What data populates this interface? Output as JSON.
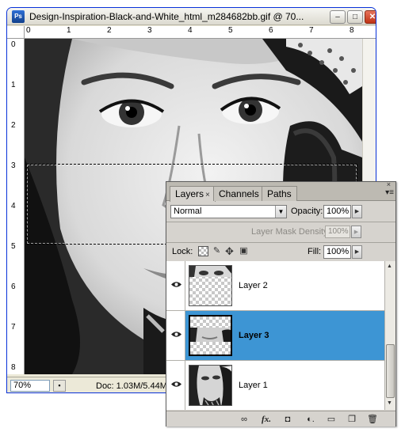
{
  "document_window": {
    "title": "Design-Inspiration-Black-and-White_html_m284682bb.gif @ 70...",
    "app_icon_text": "Ps",
    "minimize": "–",
    "maximize": "□",
    "close": "✕",
    "ruler_top_labels": [
      "0",
      "1",
      "2",
      "3",
      "4",
      "5",
      "6",
      "7",
      "8"
    ],
    "ruler_left_labels": [
      "0",
      "1",
      "2",
      "3",
      "4",
      "5",
      "6",
      "7",
      "8"
    ],
    "status": {
      "zoom": "70%",
      "doc_size": "Doc: 1.03M/5.44M"
    }
  },
  "layers_panel": {
    "tabs": [
      {
        "label": "Layers",
        "close": "×"
      },
      {
        "label": "Channels"
      },
      {
        "label": "Paths"
      }
    ],
    "menu_icon": "▾≡",
    "close_icon": "×",
    "blend_mode": "Normal",
    "opacity_label": "Opacity:",
    "opacity_value": "100%",
    "mask_density_label": "Layer Mask Density",
    "mask_density_value": "100%",
    "lock_label": "Lock:",
    "fill_label": "Fill:",
    "fill_value": "100%",
    "layers": [
      {
        "name": "Layer 2",
        "visible": true,
        "selected": false
      },
      {
        "name": "Layer 3",
        "visible": true,
        "selected": true
      },
      {
        "name": "Layer 1",
        "visible": true,
        "selected": false
      }
    ],
    "footer_icons": [
      "link-icon",
      "fx-icon",
      "layer-mask-icon",
      "adjustment-layer-icon",
      "group-folder-icon",
      "new-layer-icon",
      "trash-icon"
    ],
    "footer_labels": {
      "link": "∞",
      "fx": "fx.",
      "mask": "◘",
      "adjust": "◐.",
      "group": "▭",
      "new": "❐",
      "trash": "🗑"
    }
  },
  "colors": {
    "selection": "#3d95d4",
    "xp_blue": "#0831d9",
    "close_red": "#c03314"
  }
}
